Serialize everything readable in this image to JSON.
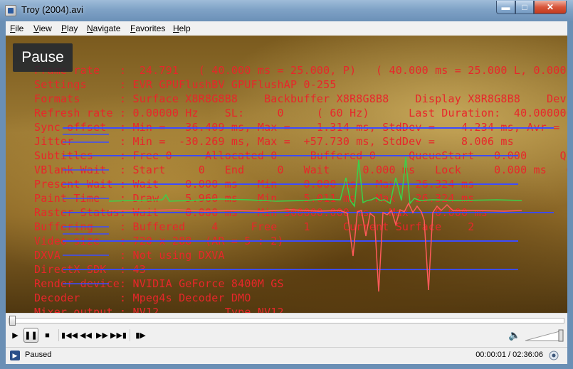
{
  "window": {
    "title": "Troy (2004).avi"
  },
  "menu": [
    "File",
    "View",
    "Play",
    "Navigate",
    "Favorites",
    "Help"
  ],
  "osd": {
    "text": "Pause"
  },
  "stats": [
    "Frame rate   :  24.791   ( 40.000 ms = 25.000, P)   ( 40.000 ms = 25.000 L, 0.000 SV",
    "Settings     : EVR GPUFlushBV GPUFlushAP 0-255",
    "Formats      : Surface X8R8G8B8    Backbuffer X8R8G8B8    Display X8R8G8B8    Devi",
    "Refresh rate : 0.00000 Hz    SL:     0     ( 60 Hz)      Last Duration:  40.000000",
    "Sync offset  : Min =   36.409 ms, Max =    1.314 ms, StdDev =    4.234 ms, Avr =   -7",
    "Jitter       : Min =  -30.269 ms, Max =  +57.730 ms, StdDev =    8.006 ms",
    "Subtitles    : Free 0     Allocated 0     Buffered 0     QueueStart   0.000     Queu",
    "VBlank Wait  : Start     0   End     0   Wait     0.000 ms   Lock     0.000 ms   Offset 30",
    "Present Wait : Wait    0.000 ms   Min    0.000 ms   Max   26.324 ms",
    "Paint Time   : Draw    5.960 ms   Min    5.011 ms   Max   26.324 ms",
    "Raster Status: Wait    0.000 ms   Min 300000.000 ms   Max    0.000 ms",
    "Buffering    : Buffered    4     Free    1     Current Surface    2",
    "Video size   : 720 x 288  (AR = 5 : 2)",
    "DXVA         : Not using DXVA",
    "DirectX SDK  : 43",
    "Render device: NVIDIA GeForce 8400M GS",
    "Decoder      : Mpeg4s Decoder DMO",
    "Mixer output : NV12          Type NV12"
  ],
  "status": {
    "text": "Paused",
    "time": "00:00:01 / 02:36:06"
  },
  "colors": {
    "stat_text": "#e8262a",
    "graph_blue": "#3d4cff",
    "graph_green": "#39d24a",
    "graph_red": "#ff5a5a"
  }
}
